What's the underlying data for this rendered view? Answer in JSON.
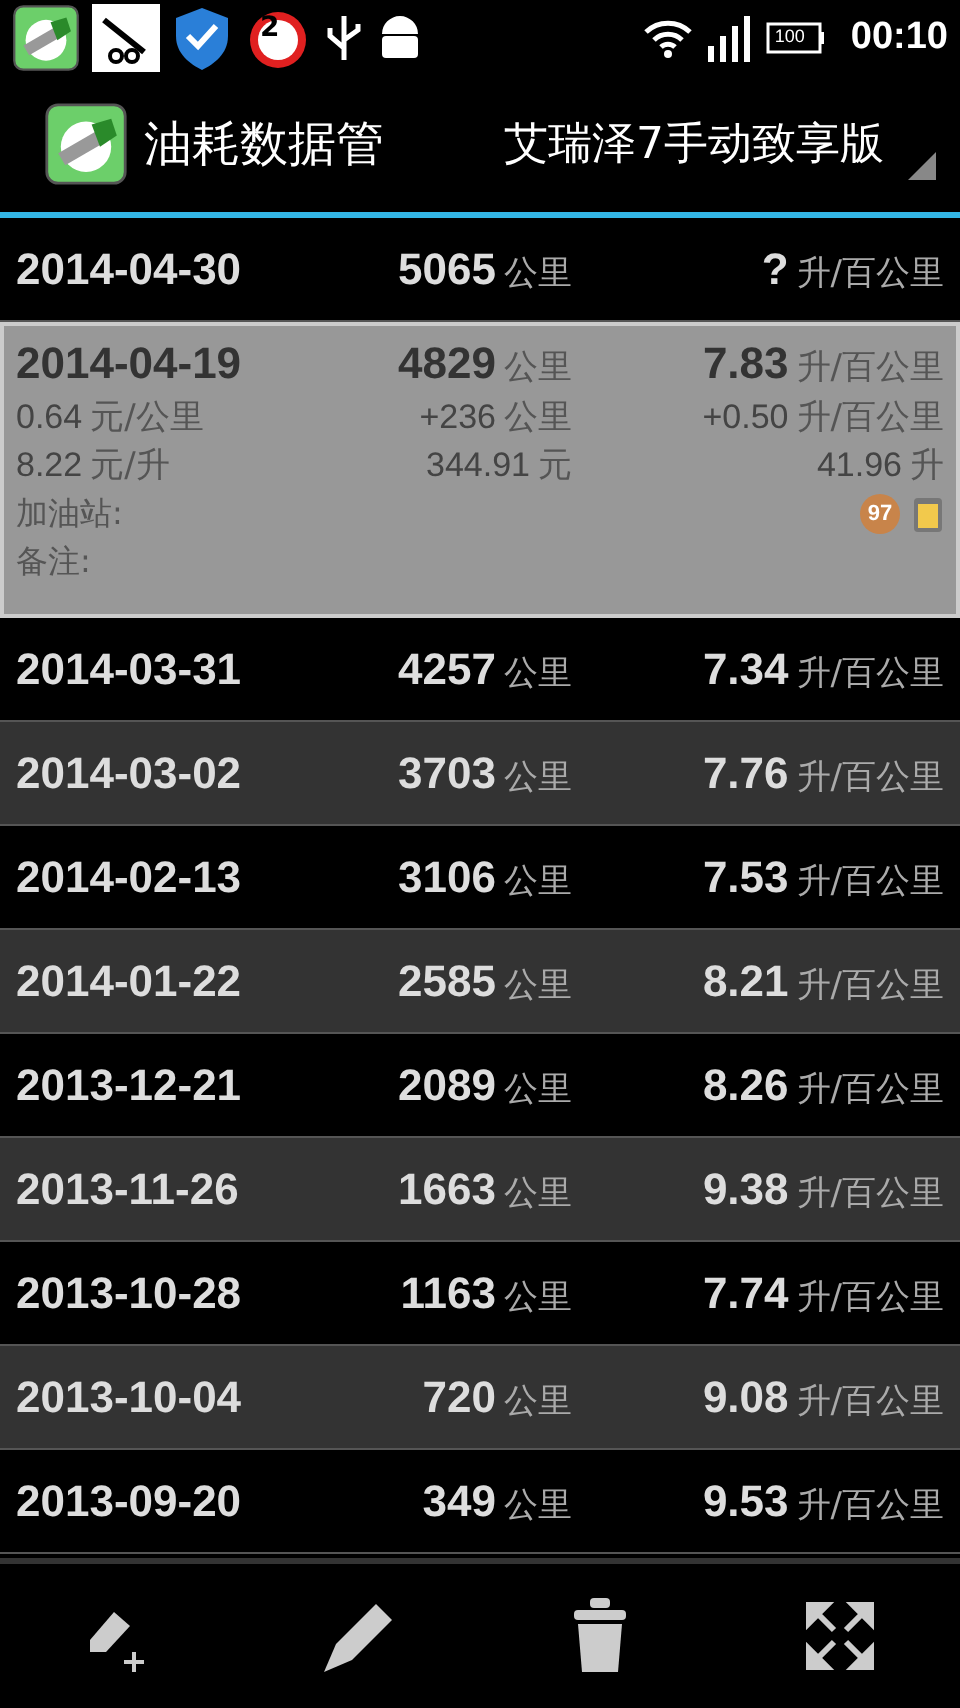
{
  "status_bar": {
    "alarm_count": "2",
    "battery": "100",
    "time": "00:10"
  },
  "action_bar": {
    "title": "油耗数据管",
    "vehicle": "艾瑞泽7手动致享版"
  },
  "records": [
    {
      "date": "2014-04-30",
      "odometer": "5065",
      "odometer_unit": "公里",
      "consumption": "?",
      "consumption_unit": "升/百公里",
      "expanded": false,
      "selected": false
    },
    {
      "date": "2014-04-19",
      "odometer": "4829",
      "odometer_unit": "公里",
      "consumption": "7.83",
      "consumption_unit": "升/百公里",
      "expanded": true,
      "selected": true,
      "details": {
        "cost_per_km": "0.64",
        "cost_per_km_unit": "元/公里",
        "distance": "+236",
        "distance_unit": "公里",
        "consumption_delta": "+0.50",
        "consumption_delta_unit": "升/百公里",
        "price": "8.22",
        "price_unit": "元/升",
        "total": "344.91",
        "total_unit": "元",
        "volume": "41.96",
        "volume_unit": "升",
        "station_label": "加油站:",
        "notes_label": "备注:",
        "fuel_grade": "97"
      }
    },
    {
      "date": "2014-03-31",
      "odometer": "4257",
      "odometer_unit": "公里",
      "consumption": "7.34",
      "consumption_unit": "升/百公里",
      "expanded": false,
      "selected": false
    },
    {
      "date": "2014-03-02",
      "odometer": "3703",
      "odometer_unit": "公里",
      "consumption": "7.76",
      "consumption_unit": "升/百公里",
      "expanded": false,
      "selected": false
    },
    {
      "date": "2014-02-13",
      "odometer": "3106",
      "odometer_unit": "公里",
      "consumption": "7.53",
      "consumption_unit": "升/百公里",
      "expanded": false,
      "selected": false
    },
    {
      "date": "2014-01-22",
      "odometer": "2585",
      "odometer_unit": "公里",
      "consumption": "8.21",
      "consumption_unit": "升/百公里",
      "expanded": false,
      "selected": false
    },
    {
      "date": "2013-12-21",
      "odometer": "2089",
      "odometer_unit": "公里",
      "consumption": "8.26",
      "consumption_unit": "升/百公里",
      "expanded": false,
      "selected": false
    },
    {
      "date": "2013-11-26",
      "odometer": "1663",
      "odometer_unit": "公里",
      "consumption": "9.38",
      "consumption_unit": "升/百公里",
      "expanded": false,
      "selected": false
    },
    {
      "date": "2013-10-28",
      "odometer": "1163",
      "odometer_unit": "公里",
      "consumption": "7.74",
      "consumption_unit": "升/百公里",
      "expanded": false,
      "selected": false
    },
    {
      "date": "2013-10-04",
      "odometer": "720",
      "odometer_unit": "公里",
      "consumption": "9.08",
      "consumption_unit": "升/百公里",
      "expanded": false,
      "selected": false
    },
    {
      "date": "2013-09-20",
      "odometer": "349",
      "odometer_unit": "公里",
      "consumption": "9.53",
      "consumption_unit": "升/百公里",
      "expanded": false,
      "selected": false
    }
  ],
  "toolbar": [
    {
      "kind": "add"
    },
    {
      "kind": "edit"
    },
    {
      "kind": "delete"
    },
    {
      "kind": "expand"
    }
  ]
}
